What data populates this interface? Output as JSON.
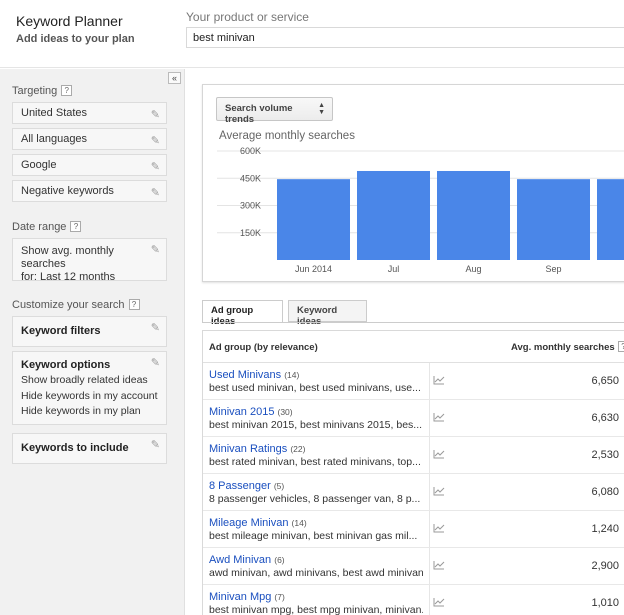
{
  "header": {
    "app_title": "Keyword Planner",
    "app_subtitle": "Add ideas to your plan",
    "product_label": "Your product or service",
    "product_value": "best minivan"
  },
  "sidebar": {
    "collapse_symbol": "«",
    "targeting": {
      "label": "Targeting",
      "items": [
        {
          "label": "United States"
        },
        {
          "label": "All languages"
        },
        {
          "label": "Google"
        },
        {
          "label": "Negative keywords"
        }
      ]
    },
    "date_range": {
      "label": "Date range",
      "line1": "Show avg. monthly searches",
      "line2": "for: Last 12 months"
    },
    "customize": {
      "label": "Customize your search",
      "keyword_filters": "Keyword filters",
      "keyword_options": {
        "title": "Keyword options",
        "lines": [
          "Show broadly related ideas",
          "Hide keywords in my account",
          "Hide keywords in my plan"
        ]
      },
      "keywords_to_include": "Keywords to include"
    },
    "help_symbol": "?",
    "pencil_symbol": "✎"
  },
  "chart_panel": {
    "button_label": "Search volume trends",
    "title": "Average monthly searches"
  },
  "chart_data": {
    "type": "bar",
    "categories": [
      "Jun 2014",
      "Jul",
      "Aug",
      "Sep",
      ""
    ],
    "values": [
      445000,
      490000,
      490000,
      445000,
      445000
    ],
    "yticks": [
      "600K",
      "450K",
      "300K",
      "150K"
    ],
    "ytick_values": [
      600000,
      450000,
      300000,
      150000
    ],
    "ylim": [
      0,
      600000
    ],
    "bar_color": "#4a86e8",
    "grid": true
  },
  "tabs": [
    {
      "label": "Ad group ideas",
      "active": true
    },
    {
      "label": "Keyword ideas",
      "active": false
    }
  ],
  "table": {
    "col_group": "Ad group (by relevance)",
    "col_avg": "Avg. monthly searches",
    "rows": [
      {
        "title": "Used Minivans",
        "count": "(14)",
        "keywords": "best used minivan, best used minivans, use...",
        "value": "6,650"
      },
      {
        "title": "Minivan 2015",
        "count": "(30)",
        "keywords": "best minivan 2015, best minivans 2015, bes...",
        "value": "6,630"
      },
      {
        "title": "Minivan Ratings",
        "count": "(22)",
        "keywords": "best rated minivan, best rated minivans, top...",
        "value": "2,530"
      },
      {
        "title": "8 Passenger",
        "count": "(5)",
        "keywords": "8 passenger vehicles, 8 passenger van, 8 p...",
        "value": "6,080"
      },
      {
        "title": "Mileage Minivan",
        "count": "(14)",
        "keywords": "best mileage minivan, best minivan gas mil...",
        "value": "1,240"
      },
      {
        "title": "Awd Minivan",
        "count": "(6)",
        "keywords": "awd minivan, awd minivans, best awd minivan...",
        "value": "2,900"
      },
      {
        "title": "Minivan Mpg",
        "count": "(7)",
        "keywords": "best minivan mpg, best mpg minivan, minivan...",
        "value": "1,010"
      }
    ]
  }
}
